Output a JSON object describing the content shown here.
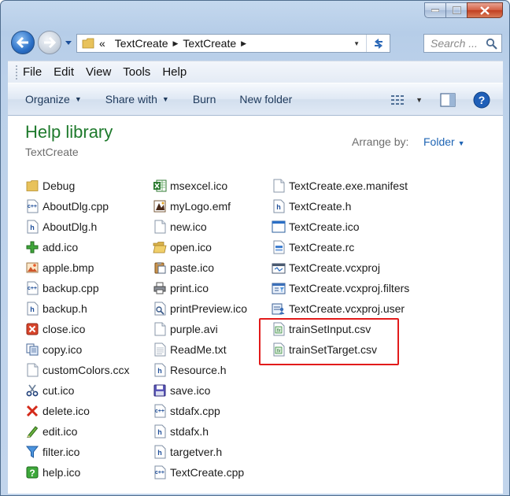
{
  "address": {
    "overflow": "«",
    "crumbs": [
      "TextCreate",
      "TextCreate"
    ],
    "search_placeholder": "Search ..."
  },
  "menu": [
    "File",
    "Edit",
    "View",
    "Tools",
    "Help"
  ],
  "commands": {
    "organize": "Organize",
    "share": "Share with",
    "burn": "Burn",
    "new_folder": "New folder"
  },
  "library": {
    "title": "Help library",
    "subtitle": "TextCreate",
    "arrange_label": "Arrange by:",
    "arrange_value": "Folder"
  },
  "files": {
    "col1": [
      {
        "name": "Debug",
        "icon": "folder-icon"
      },
      {
        "name": "AboutDlg.cpp",
        "icon": "cpp-file-icon"
      },
      {
        "name": "AboutDlg.h",
        "icon": "h-file-icon"
      },
      {
        "name": "add.ico",
        "icon": "add-icon"
      },
      {
        "name": "apple.bmp",
        "icon": "bmp-icon"
      },
      {
        "name": "backup.cpp",
        "icon": "cpp-file-icon"
      },
      {
        "name": "backup.h",
        "icon": "h-file-icon"
      },
      {
        "name": "close.ico",
        "icon": "close-icon"
      },
      {
        "name": "copy.ico",
        "icon": "copy-icon"
      },
      {
        "name": "customColors.ccx",
        "icon": "blank-file-icon"
      },
      {
        "name": "cut.ico",
        "icon": "scissors-icon"
      },
      {
        "name": "delete.ico",
        "icon": "delete-icon"
      },
      {
        "name": "edit.ico",
        "icon": "pencil-icon"
      },
      {
        "name": "filter.ico",
        "icon": "filter-icon"
      },
      {
        "name": "help.ico",
        "icon": "help-icon"
      }
    ],
    "col2": [
      {
        "name": "msexcel.ico",
        "icon": "excel-icon"
      },
      {
        "name": "myLogo.emf",
        "icon": "image-icon"
      },
      {
        "name": "new.ico",
        "icon": "blank-file-icon"
      },
      {
        "name": "open.ico",
        "icon": "open-folder-icon"
      },
      {
        "name": "paste.ico",
        "icon": "paste-icon"
      },
      {
        "name": "print.ico",
        "icon": "printer-icon"
      },
      {
        "name": "printPreview.ico",
        "icon": "print-preview-icon"
      },
      {
        "name": "purple.avi",
        "icon": "blank-file-icon"
      },
      {
        "name": "ReadMe.txt",
        "icon": "text-file-icon"
      },
      {
        "name": "Resource.h",
        "icon": "h-file-icon"
      },
      {
        "name": "save.ico",
        "icon": "floppy-icon"
      },
      {
        "name": "stdafx.cpp",
        "icon": "cpp-file-icon"
      },
      {
        "name": "stdafx.h",
        "icon": "h-file-icon"
      },
      {
        "name": "targetver.h",
        "icon": "h-file-icon"
      },
      {
        "name": "TextCreate.cpp",
        "icon": "cpp-file-icon"
      }
    ],
    "col3": [
      {
        "name": "TextCreate.exe.manifest",
        "icon": "blank-file-icon"
      },
      {
        "name": "TextCreate.h",
        "icon": "h-file-icon"
      },
      {
        "name": "TextCreate.ico",
        "icon": "window-icon"
      },
      {
        "name": "TextCreate.rc",
        "icon": "rc-file-icon"
      },
      {
        "name": "TextCreate.vcxproj",
        "icon": "project-icon"
      },
      {
        "name": "TextCreate.vcxproj.filters",
        "icon": "project-filters-icon"
      },
      {
        "name": "TextCreate.vcxproj.user",
        "icon": "project-user-icon"
      },
      {
        "name": "trainSetInput.csv",
        "icon": "csv-icon"
      },
      {
        "name": "trainSetTarget.csv",
        "icon": "csv-icon"
      }
    ]
  },
  "colors": {
    "title_green": "#1e7a2c",
    "link_blue": "#1e64b4",
    "highlight_red": "#e21b1b"
  }
}
